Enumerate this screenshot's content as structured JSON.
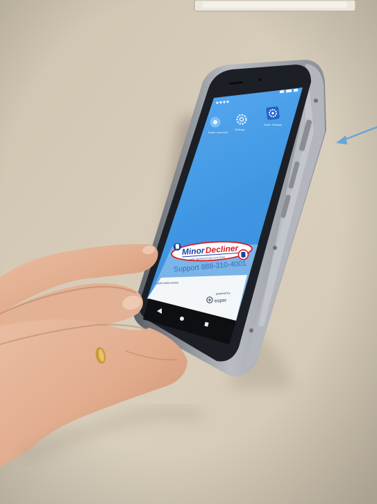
{
  "photo": {
    "colors": {
      "wall": "#d9cfbd",
      "wall_shadow": "#b9ae9a",
      "phone_frame": "#9ea2a8",
      "phone_body": "#1c1f25",
      "screen": "#3f9be6",
      "screen_bottom": "#e7edf3",
      "nav_bar": "#0e0f12",
      "skin": "#e8b79a",
      "arrow": "#6aa4d8",
      "brand_red": "#d41f26",
      "brand_blue": "#1a3fa0"
    },
    "screen": {
      "app_icons": [
        {
          "name": "Esper Launcher",
          "icon": "circle-app-icon"
        },
        {
          "name": "Settings",
          "icon": "gear-icon"
        },
        {
          "name": "Esper Settings",
          "icon": "gear-badge-icon"
        }
      ],
      "logo": {
        "word1": "Minor",
        "word2": "Decliner",
        "tagline": "AGE VERIFICATION SYSTEMS"
      },
      "support_text": "Support 888-310-4001",
      "device_id": "ESPR-DMO-AA4D5",
      "powered_by": "powered by",
      "esper": "esper"
    }
  }
}
